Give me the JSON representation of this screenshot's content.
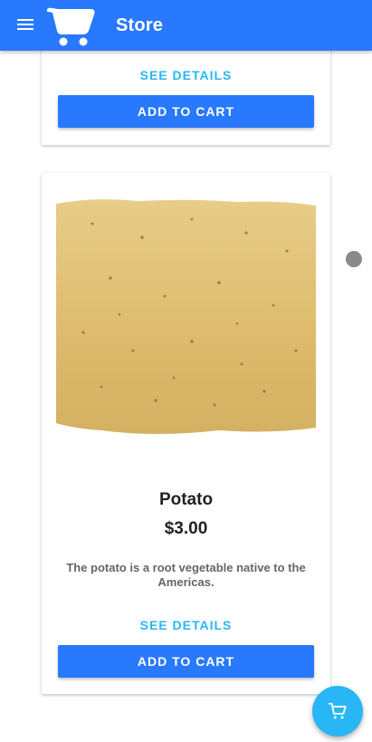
{
  "app": {
    "title": "Store",
    "brand_color": "#2979ff",
    "accent_color": "#29b6f6"
  },
  "products": [
    {
      "details_label": "SEE DETAILS",
      "add_label": "ADD TO CART"
    },
    {
      "name": "Potato",
      "price": "$3.00",
      "description": "The potato is a root vegetable native to the Americas.",
      "details_label": "SEE DETAILS",
      "add_label": "ADD TO CART",
      "image_icon": "potato-image"
    }
  ],
  "fab": {
    "icon": "cart-icon"
  }
}
